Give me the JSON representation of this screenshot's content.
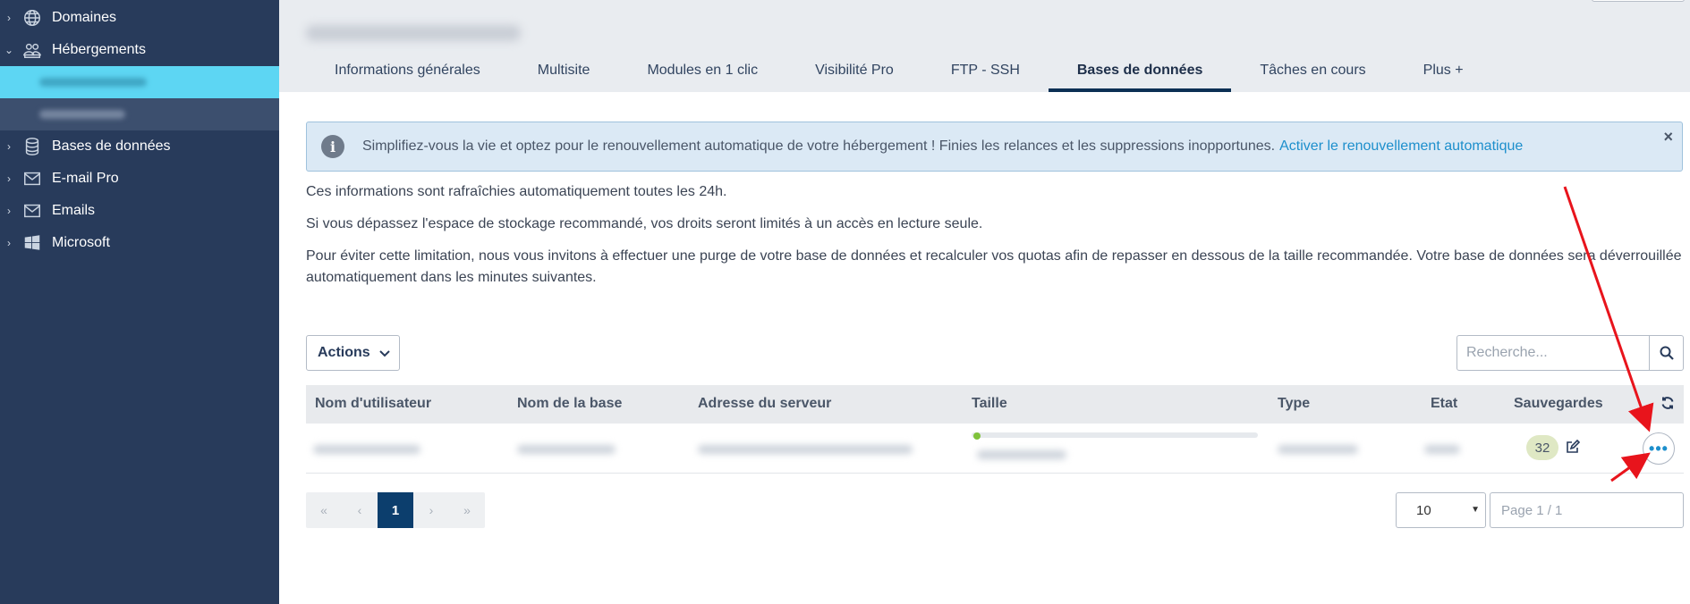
{
  "sidebar": {
    "items": [
      {
        "label": "Domaines",
        "icon": "globe-icon",
        "chevron": "›"
      },
      {
        "label": "Hébergements",
        "icon": "users-icon",
        "chevron": "⌄"
      },
      {
        "label": "Bases de données",
        "icon": "database-icon",
        "chevron": "›"
      },
      {
        "label": "E-mail Pro",
        "icon": "envelope-icon",
        "chevron": "›"
      },
      {
        "label": "Emails",
        "icon": "envelope-icon",
        "chevron": "›"
      },
      {
        "label": "Microsoft",
        "icon": "windows-icon",
        "chevron": "›"
      }
    ]
  },
  "tabs": [
    "Informations générales",
    "Multisite",
    "Modules en 1 clic",
    "Visibilité Pro",
    "FTP - SSH",
    "Bases de données",
    "Tâches en cours",
    "Plus +"
  ],
  "active_tab": "Bases de données",
  "banner": {
    "text": "Simplifiez-vous la vie et optez pour le renouvellement automatique de votre hébergement ! Finies les relances et les suppressions inopportunes.",
    "link": "Activer le renouvellement automatique",
    "close": "×",
    "icon": "info-icon"
  },
  "paragraphs": {
    "p1": "Ces informations sont rafraîchies automatiquement toutes les 24h.",
    "p2": "Si vous dépassez l'espace de stockage recommandé, vos droits seront limités à un accès en lecture seule.",
    "p3": "Pour éviter cette limitation, nous vous invitons à effectuer une purge de votre base de données et recalculer vos quotas afin de repasser en dessous de la taille recommandée. Votre base de données sera déverrouillée automatiquement dans les minutes suivantes."
  },
  "toolbar": {
    "actions_label": "Actions",
    "search_placeholder": "Recherche..."
  },
  "table": {
    "columns": [
      "Nom d'utilisateur",
      "Nom de la base",
      "Adresse du serveur",
      "Taille",
      "Type",
      "Etat",
      "Sauvegardes"
    ],
    "rows": [
      {
        "backups": "32",
        "more": "•••"
      }
    ]
  },
  "pagination": {
    "first": "«",
    "prev": "‹",
    "current": "1",
    "next": "›",
    "last": "»",
    "page_size": "10",
    "page_info_placeholder": "Page 1 / 1"
  },
  "colors": {
    "sidebar_bg": "#283b5b",
    "active_sub_item": "#5dd6f3",
    "active_tab_underline": "#0c3054",
    "link": "#1d8fcc",
    "annotation_arrow": "#e8141c"
  }
}
